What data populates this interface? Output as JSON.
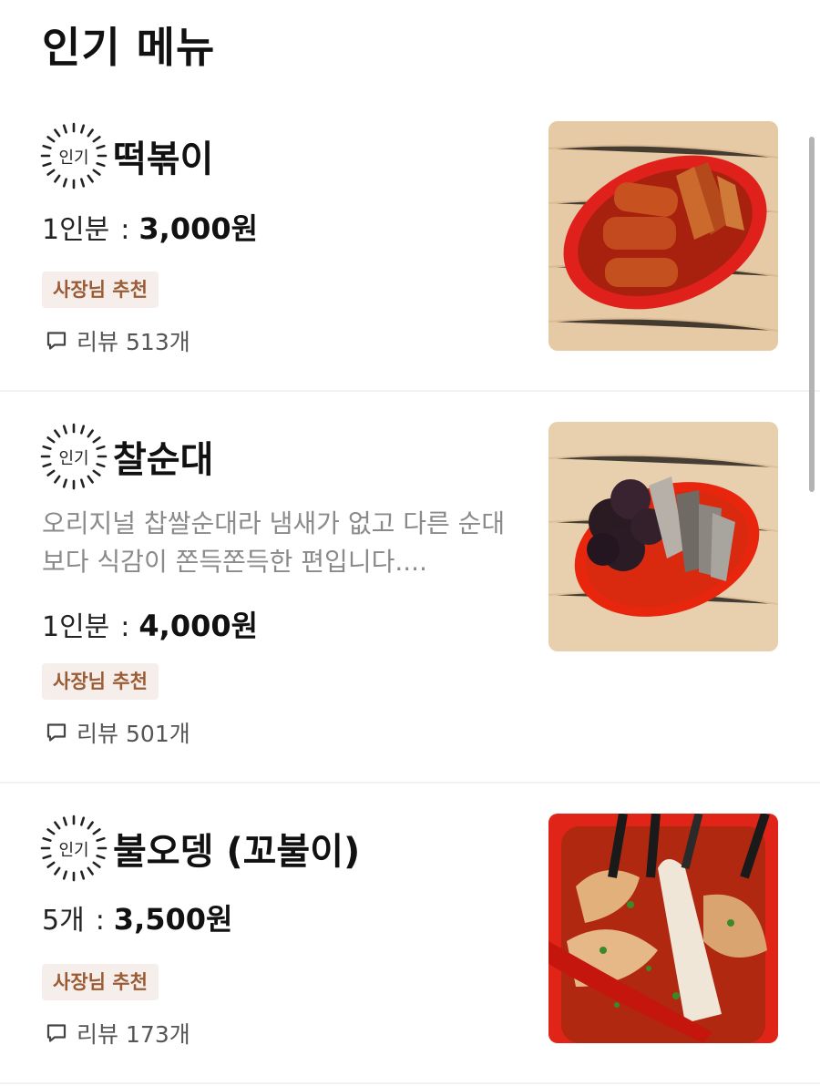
{
  "section": {
    "title": "인기 메뉴"
  },
  "items": [
    {
      "badge": "인기",
      "name": "떡볶이",
      "description": [],
      "price_unit": "1인분",
      "price": "3,000원",
      "tag": "사장님 추천",
      "review_label": "리뷰",
      "review_count": "513개",
      "photo": "tteokbokki-photo"
    },
    {
      "badge": "인기",
      "name": "찰순대",
      "description": [
        "오리지널 찹쌀순대라 냄새가 없고 다른 순대",
        "보다 식감이 쫀득쫀득한 편입니다...."
      ],
      "price_unit": "1인분",
      "price": "4,000원",
      "tag": "사장님 추천",
      "review_label": "리뷰",
      "review_count": "501개",
      "photo": "sundae-photo"
    },
    {
      "badge": "인기",
      "name": "불오뎅 (꼬불이)",
      "description": [],
      "price_unit": "5개",
      "price": "3,500원",
      "tag": "사장님 추천",
      "review_label": "리뷰",
      "review_count": "173개",
      "photo": "fish-cake-photo"
    }
  ],
  "price_separator": ":",
  "colors": {
    "tag_bg": "#f5eeea",
    "tag_text": "#9a5b35",
    "description": "#8a8a8a",
    "divider": "#f1f1f1"
  }
}
